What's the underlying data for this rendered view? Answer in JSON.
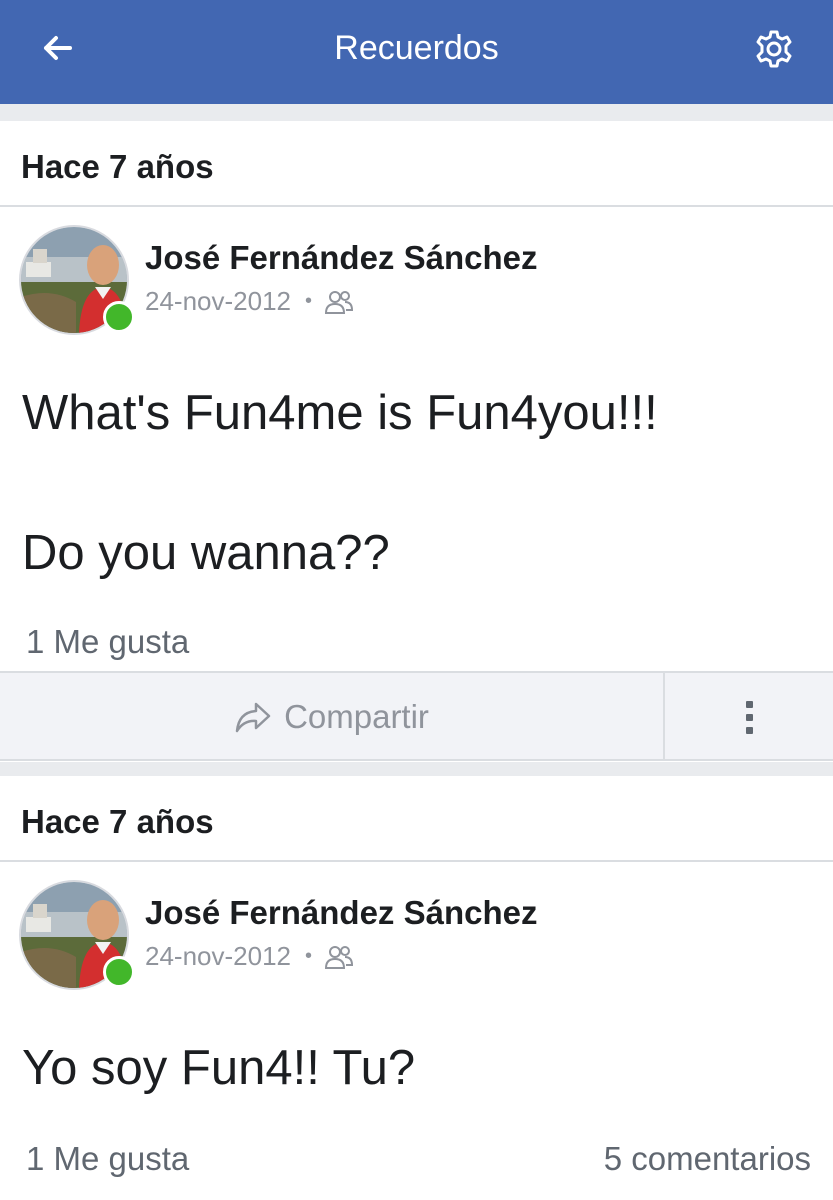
{
  "header": {
    "title": "Recuerdos",
    "back_icon": "arrow-left-icon",
    "settings_icon": "gear-icon",
    "color": "#4267b2"
  },
  "memories": [
    {
      "section_label": "Hace 7 años",
      "author": "José Fernández Sánchez",
      "date": "24-nov-2012",
      "audience_icon": "friends-icon",
      "text_lines": [
        "What's Fun4me is Fun4you!!!",
        "",
        "Do you wanna??"
      ],
      "likes": "1 Me gusta",
      "share_label": "Compartir",
      "online": true
    },
    {
      "section_label": "Hace 7 años",
      "author": "José Fernández Sánchez",
      "date": "24-nov-2012",
      "audience_icon": "friends-icon",
      "text_lines": [
        "Yo soy Fun4!! Tu?"
      ],
      "likes": "1 Me gusta",
      "comments": "5 comentarios",
      "online": true
    }
  ],
  "colors": {
    "online": "#42b72a",
    "muted": "#90949c",
    "text": "#1c1e21"
  }
}
